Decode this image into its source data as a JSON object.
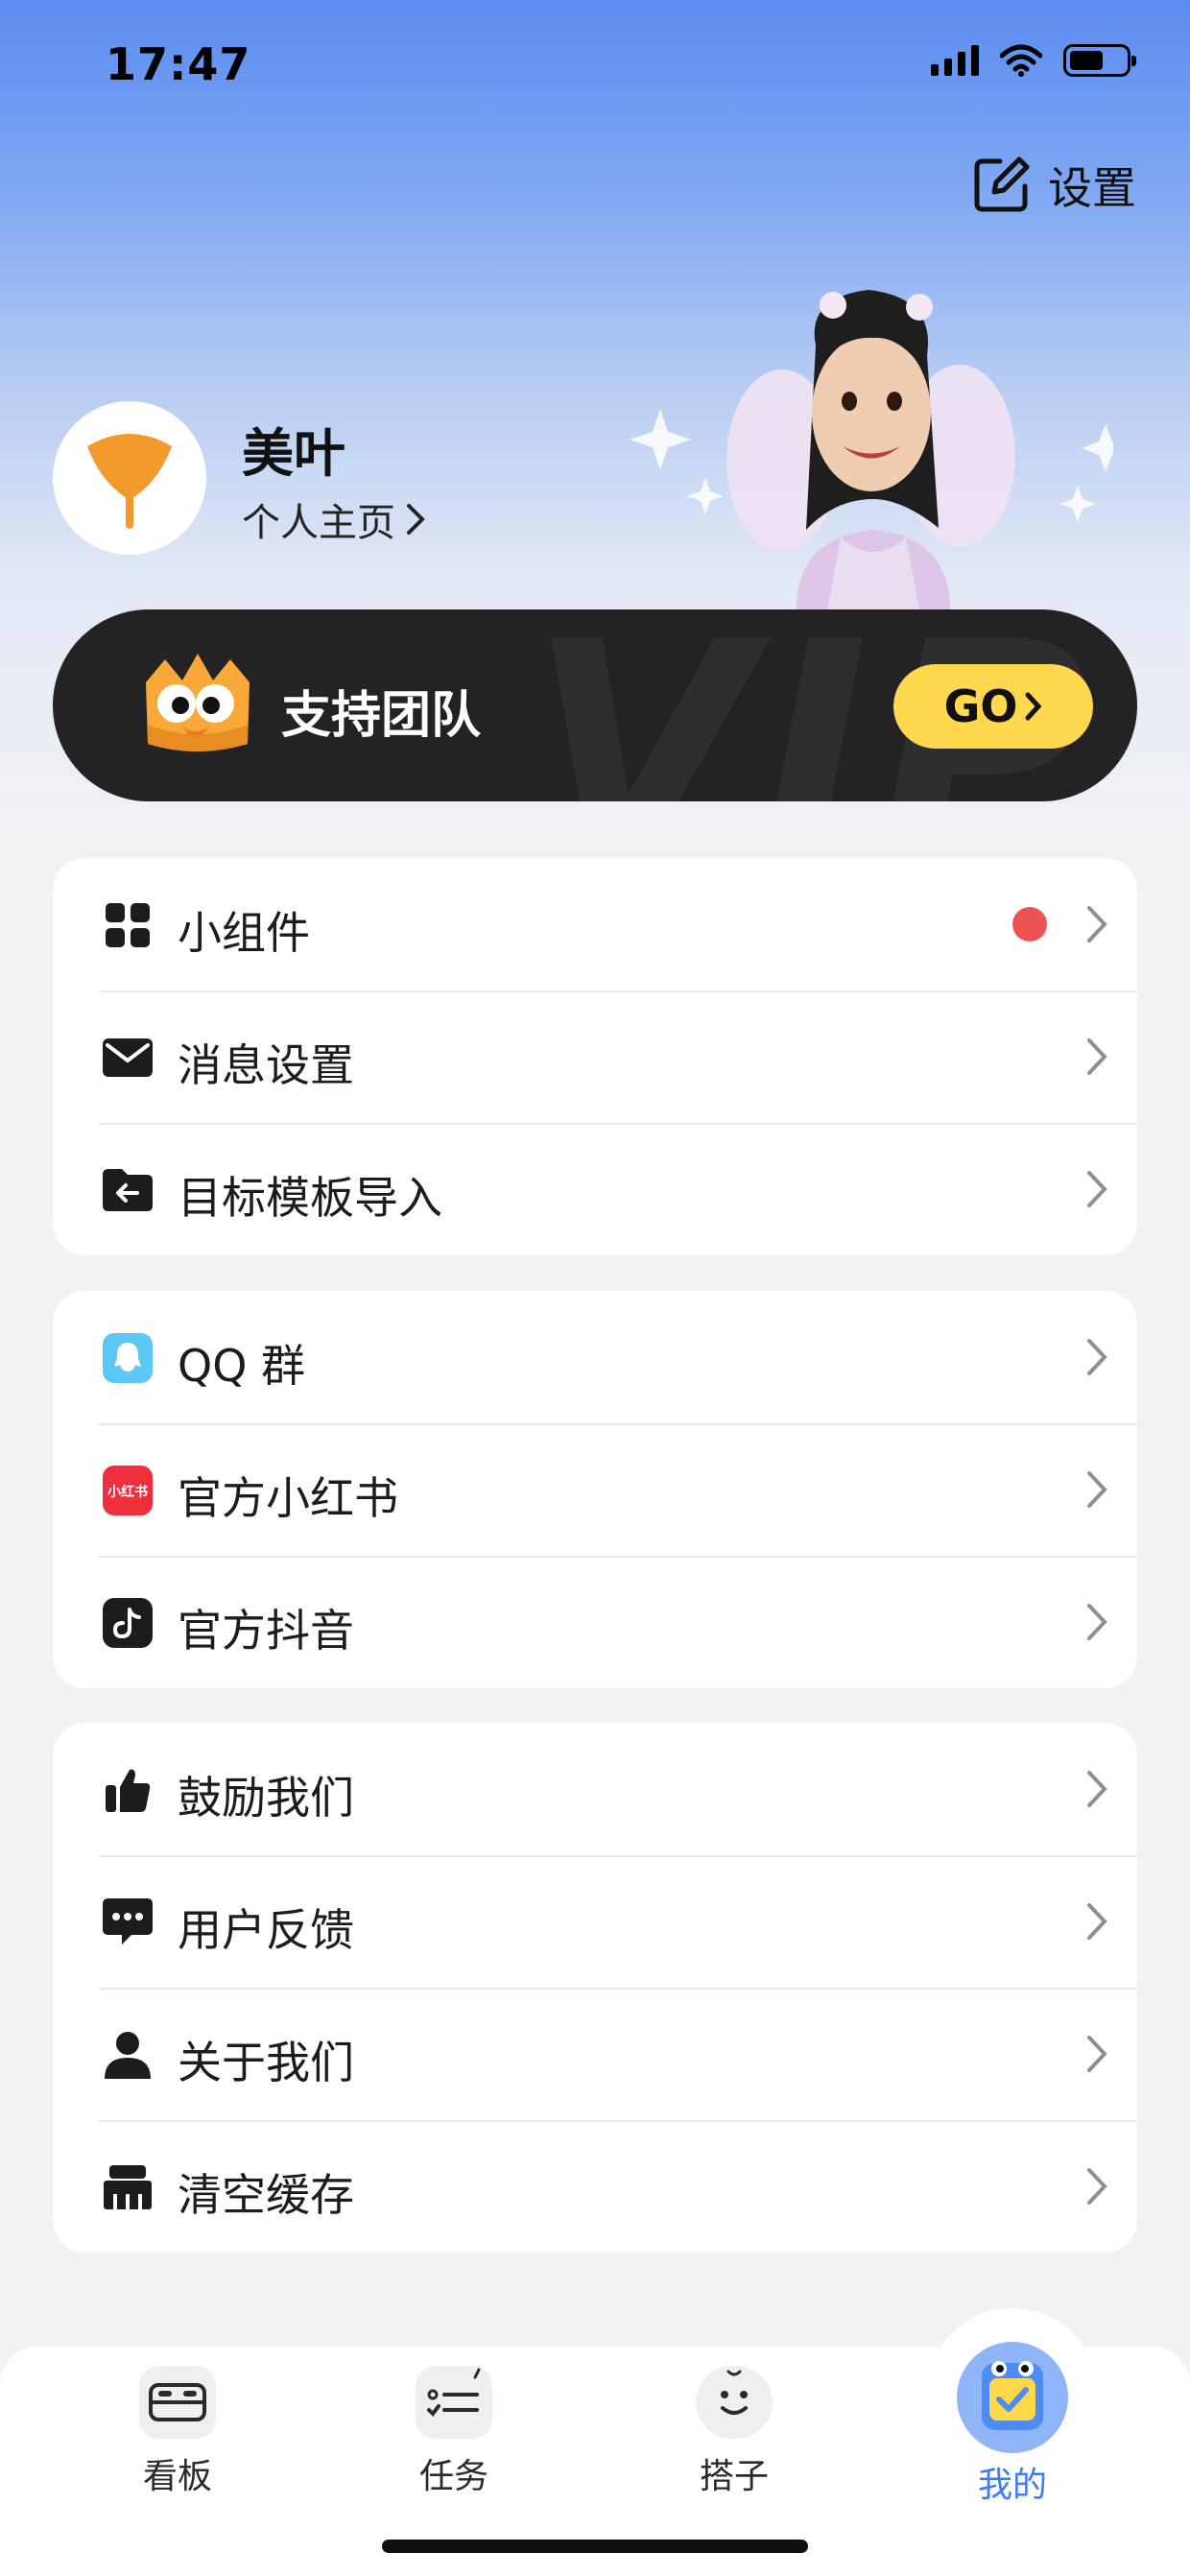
{
  "status_bar": {
    "time": "17:47"
  },
  "header": {
    "settings_label": "设置",
    "username": "美叶",
    "home_link": "个人主页"
  },
  "vip_banner": {
    "title": "支持团队",
    "go_label": "GO",
    "watermark": "VIP"
  },
  "groups": [
    {
      "items": [
        {
          "label": "小组件",
          "icon": "widgets-icon",
          "has_badge": true
        },
        {
          "label": "消息设置",
          "icon": "mail-icon"
        },
        {
          "label": "目标模板导入",
          "icon": "folder-import-icon"
        }
      ]
    },
    {
      "items": [
        {
          "label": "QQ 群",
          "icon": "qq-icon"
        },
        {
          "label": "官方小红书",
          "icon": "xiaohongshu-icon",
          "icon_text": "小红书"
        },
        {
          "label": "官方抖音",
          "icon": "douyin-icon"
        }
      ]
    },
    {
      "items": [
        {
          "label": "鼓励我们",
          "icon": "thumbs-up-icon"
        },
        {
          "label": "用户反馈",
          "icon": "chat-bubble-icon"
        },
        {
          "label": "关于我们",
          "icon": "person-icon"
        },
        {
          "label": "清空缓存",
          "icon": "broom-icon"
        }
      ]
    }
  ],
  "tabs": [
    {
      "label": "看板",
      "icon": "board-icon"
    },
    {
      "label": "任务",
      "icon": "task-list-icon"
    },
    {
      "label": "搭子",
      "icon": "buddy-icon"
    },
    {
      "label": "我的",
      "icon": "mine-icon",
      "active": true
    }
  ],
  "colors": {
    "accent": "#3A7BF7",
    "go_button": "#FFD84D",
    "badge": "#EE5353",
    "vip_bg": "#232325"
  }
}
